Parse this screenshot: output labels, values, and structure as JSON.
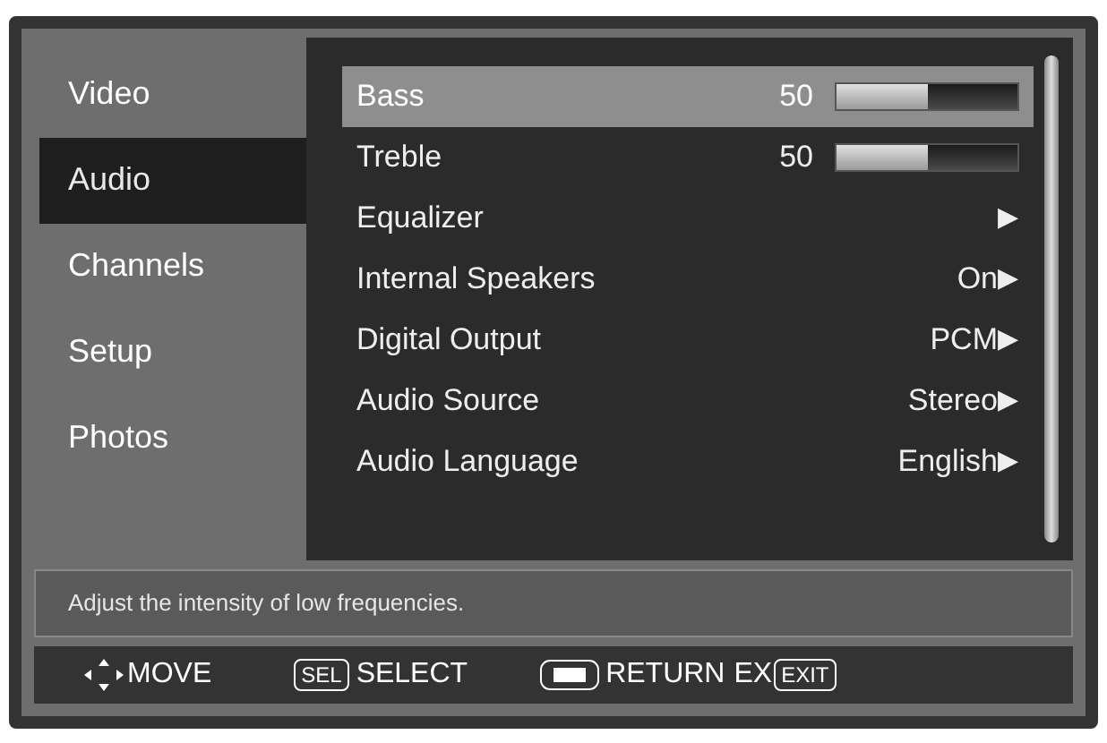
{
  "sidebar": {
    "items": [
      {
        "label": "Video",
        "selected": false
      },
      {
        "label": "Audio",
        "selected": true
      },
      {
        "label": "Channels",
        "selected": false
      },
      {
        "label": "Setup",
        "selected": false
      },
      {
        "label": "Photos",
        "selected": false
      }
    ]
  },
  "settings": [
    {
      "kind": "slider",
      "label": "Bass",
      "reading": "50",
      "level": 0.5,
      "selected": true
    },
    {
      "kind": "slider",
      "label": "Treble",
      "reading": "50",
      "level": 0.5,
      "selected": false
    },
    {
      "kind": "submenu",
      "label": "Equalizer",
      "arrow": "▶",
      "selected": false
    },
    {
      "kind": "submenu",
      "label": "Internal Speakers",
      "value": "On",
      "arrow": "▶",
      "selected": false
    },
    {
      "kind": "submenu",
      "label": "Digital Output",
      "value": "PCM",
      "arrow": "▶",
      "selected": false
    },
    {
      "kind": "submenu",
      "label": "Audio Source",
      "value": "Stereo",
      "arrow": "▶",
      "selected": false
    },
    {
      "kind": "submenu",
      "label": "Audio Language",
      "value": "English",
      "arrow": "▶",
      "selected": false
    }
  ],
  "help_text": "Adjust the intensity of low frequencies.",
  "footer": {
    "move": "MOVE",
    "sel_key": "SEL",
    "select": "SELECT",
    "return": "RETURN",
    "ex": "EX",
    "exit_key": "EXIT"
  }
}
